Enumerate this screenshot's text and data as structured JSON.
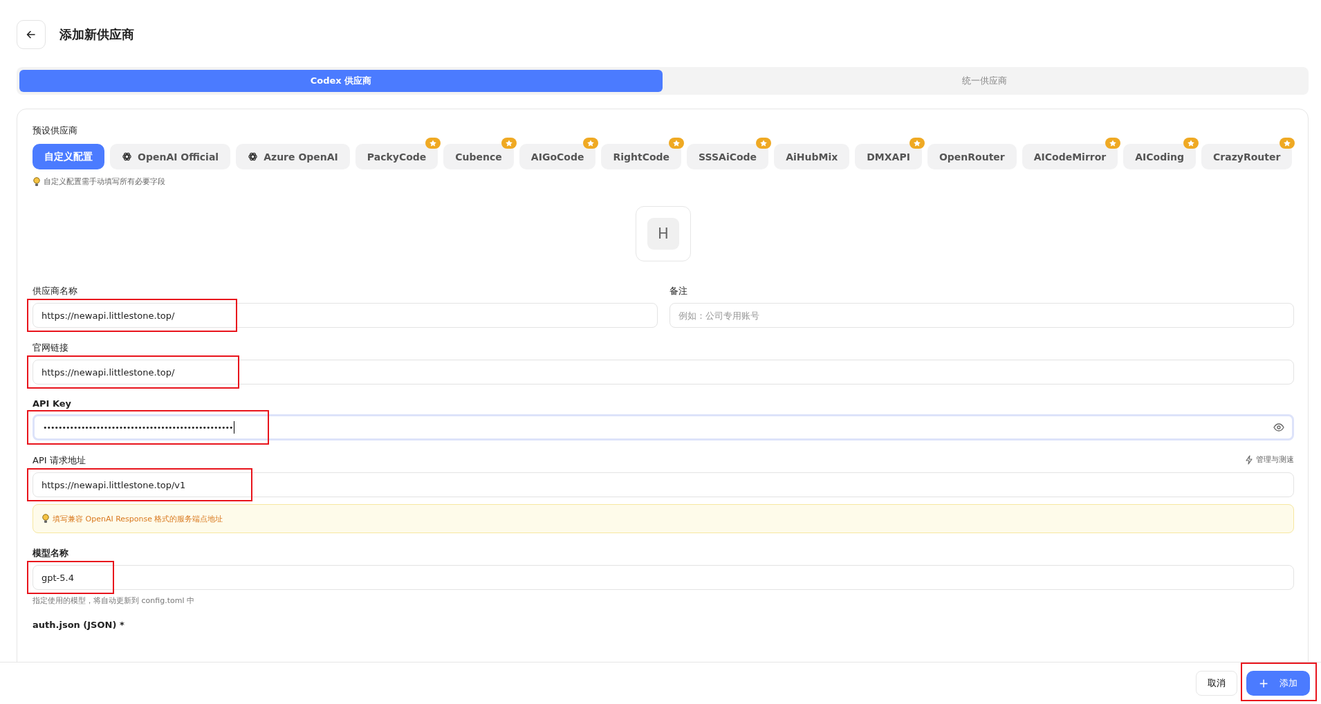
{
  "header": {
    "title": "添加新供应商"
  },
  "tabs": [
    {
      "label": "Codex 供应商",
      "selected": true
    },
    {
      "label": "统一供应商",
      "selected": false
    }
  ],
  "presets": {
    "label": "预设供应商",
    "hint": "自定义配置需手动填写所有必要字段",
    "chips": [
      {
        "label": "自定义配置",
        "selected": true,
        "kind": "plain",
        "starred": false
      },
      {
        "label": "OpenAI Official",
        "selected": false,
        "kind": "official",
        "starred": false
      },
      {
        "label": "Azure OpenAI",
        "selected": false,
        "kind": "official",
        "starred": false
      },
      {
        "label": "PackyCode",
        "selected": false,
        "kind": "plain",
        "starred": true
      },
      {
        "label": "Cubence",
        "selected": false,
        "kind": "plain",
        "starred": true
      },
      {
        "label": "AIGoCode",
        "selected": false,
        "kind": "plain",
        "starred": true
      },
      {
        "label": "RightCode",
        "selected": false,
        "kind": "plain",
        "starred": true
      },
      {
        "label": "SSSAiCode",
        "selected": false,
        "kind": "plain",
        "starred": true
      },
      {
        "label": "AiHubMix",
        "selected": false,
        "kind": "plain",
        "starred": false
      },
      {
        "label": "DMXAPI",
        "selected": false,
        "kind": "plain",
        "starred": true
      },
      {
        "label": "OpenRouter",
        "selected": false,
        "kind": "plain",
        "starred": false
      },
      {
        "label": "AICodeMirror",
        "selected": false,
        "kind": "plain",
        "starred": true
      },
      {
        "label": "AICoding",
        "selected": false,
        "kind": "plain",
        "starred": true
      },
      {
        "label": "CrazyRouter",
        "selected": false,
        "kind": "plain",
        "starred": true
      }
    ]
  },
  "avatar": {
    "letter": "H"
  },
  "fields": {
    "name": {
      "label": "供应商名称",
      "value": "https://newapi.littlestone.top/",
      "highlighted": true
    },
    "note": {
      "label": "备注",
      "placeholder": "例如：公司专用账号"
    },
    "website": {
      "label": "官网链接",
      "value": "https://newapi.littlestone.top/",
      "highlighted": true
    },
    "api_key": {
      "label": "API Key",
      "value": "••••••••••••••••••••••••••••••••••••••••••••••••••",
      "highlighted": true,
      "focused": true
    },
    "endpoint": {
      "label": "API 请求地址",
      "value": "https://newapi.littlestone.top/v1",
      "highlighted": true,
      "action": "管理与测速",
      "warning": "填写兼容 OpenAI Response 格式的服务端点地址"
    },
    "model": {
      "label": "模型名称",
      "value": "gpt-5.4",
      "highlighted": true,
      "hint": "指定使用的模型，将自动更新到 config.toml 中"
    },
    "auth": {
      "label": "auth.json (JSON) *"
    }
  },
  "footer": {
    "cancel": "取消",
    "add": {
      "icon": "+",
      "label": "添加",
      "highlighted": true
    }
  }
}
